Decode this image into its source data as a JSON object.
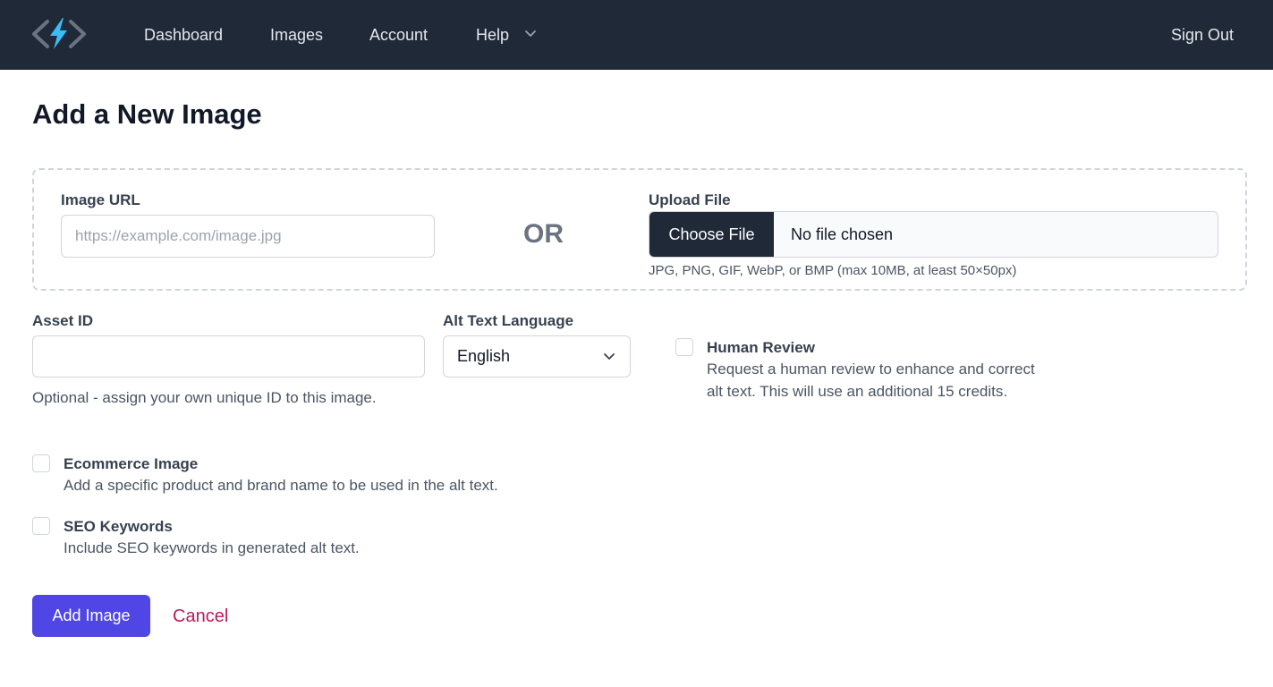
{
  "nav": {
    "logo_icon": "bolt-code-logo",
    "links": [
      "Dashboard",
      "Images",
      "Account",
      "Help"
    ],
    "help_chevron_icon": "chevron-down-icon",
    "sign_out": "Sign Out"
  },
  "page": {
    "title": "Add a New Image"
  },
  "source": {
    "url_label": "Image URL",
    "url_placeholder": "https://example.com/image.jpg",
    "url_value": "",
    "or_text": "OR",
    "upload_label": "Upload File",
    "choose_file": "Choose File",
    "no_file": "No file chosen",
    "file_hint": "JPG, PNG, GIF, WebP, or BMP (max 10MB, at least 50×50px)"
  },
  "asset": {
    "label": "Asset ID",
    "value": "",
    "help": "Optional - assign your own unique ID to this image."
  },
  "language": {
    "label": "Alt Text Language",
    "selected": "English"
  },
  "options": {
    "human_review": {
      "title": "Human Review",
      "description": "Request a human review to enhance and correct alt text. This will use an additional 15 credits."
    },
    "ecommerce": {
      "title": "Ecommerce Image",
      "description": "Add a specific product and brand name to be used in the alt text."
    },
    "seo": {
      "title": "SEO Keywords",
      "description": "Include SEO keywords in generated alt text."
    }
  },
  "actions": {
    "submit": "Add Image",
    "cancel": "Cancel"
  },
  "colors": {
    "navbar": "#1f2937",
    "logo_bolt": "#38bdf8",
    "primary_button": "#4f46e5",
    "cancel_link": "#be185d"
  }
}
